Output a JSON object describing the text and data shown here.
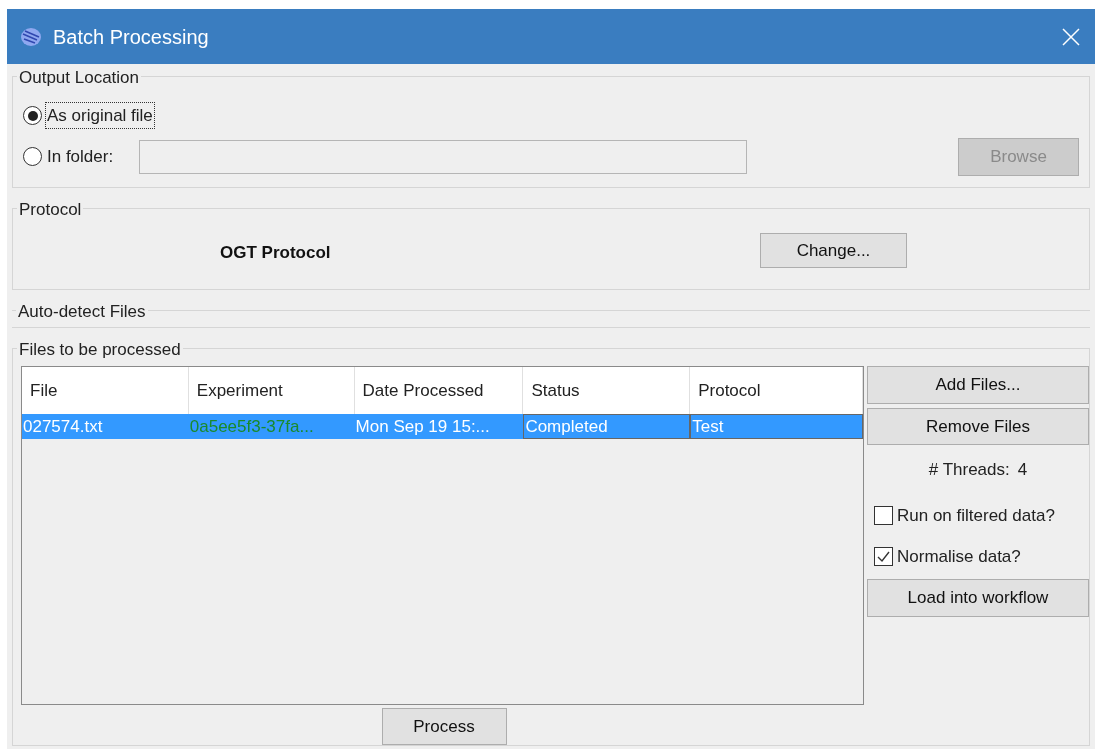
{
  "window": {
    "title": "Batch Processing"
  },
  "output_location": {
    "title": "Output Location",
    "options": [
      {
        "label": "As original file",
        "selected": true,
        "focused": true
      },
      {
        "label": "In folder:",
        "selected": false,
        "focused": false
      }
    ],
    "folder_field": {
      "disabled": true
    },
    "browse_button": {
      "label": "Browse",
      "disabled": true
    }
  },
  "protocol": {
    "title": "Protocol",
    "name": "OGT Protocol",
    "change_button": "Change..."
  },
  "auto_detect": {
    "title": "Auto-detect Files"
  },
  "files": {
    "title": "Files to be processed",
    "columns": [
      "File",
      "Experiment",
      "Date Processed",
      "Status",
      "Protocol"
    ],
    "rows": [
      {
        "cells": [
          "027574.txt",
          "0a5ee5f3-37fa...",
          "Mon Sep 19 15:...",
          "Completed",
          "Test"
        ],
        "selected": true
      }
    ],
    "add_button": "Add Files...",
    "remove_button": "Remove Files",
    "threads_label": "# Threads:",
    "threads_value": "4",
    "options": [
      {
        "label": "Run on filtered data?",
        "checked": false
      },
      {
        "label": "Normalise data?",
        "checked": true
      }
    ],
    "load_button": "Load into workflow",
    "process_button": "Process"
  }
}
